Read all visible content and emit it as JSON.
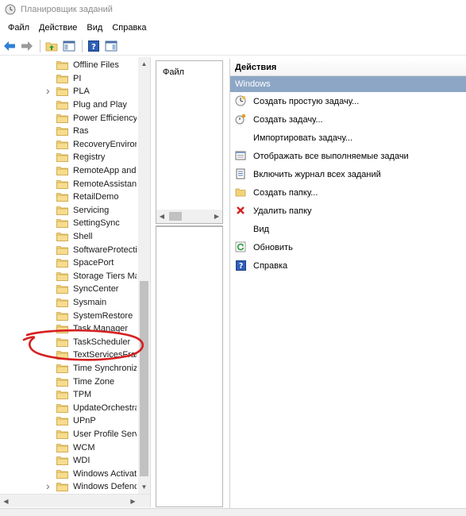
{
  "window": {
    "title": "Планировщик заданий",
    "app_icon": "clock-icon"
  },
  "menu": {
    "items": [
      "Файл",
      "Действие",
      "Вид",
      "Справка"
    ]
  },
  "toolbar": {
    "buttons": [
      "back-arrow-icon",
      "forward-arrow-icon",
      "folder-up-icon",
      "show-hide-tree-icon",
      "help-icon",
      "show-hide-action-pane-icon"
    ]
  },
  "tree": {
    "items": [
      {
        "label": "Offline Files",
        "expandable": false
      },
      {
        "label": "PI",
        "expandable": false
      },
      {
        "label": "PLA",
        "expandable": true
      },
      {
        "label": "Plug and Play",
        "expandable": false
      },
      {
        "label": "Power Efficiency",
        "expandable": false
      },
      {
        "label": "Ras",
        "expandable": false
      },
      {
        "label": "RecoveryEnviron",
        "expandable": false
      },
      {
        "label": "Registry",
        "expandable": false
      },
      {
        "label": "RemoteApp and",
        "expandable": false
      },
      {
        "label": "RemoteAssistanc",
        "expandable": false
      },
      {
        "label": "RetailDemo",
        "expandable": false
      },
      {
        "label": "Servicing",
        "expandable": false
      },
      {
        "label": "SettingSync",
        "expandable": false
      },
      {
        "label": "Shell",
        "expandable": false
      },
      {
        "label": "SoftwareProtecti",
        "expandable": false
      },
      {
        "label": "SpacePort",
        "expandable": false
      },
      {
        "label": "Storage Tiers Ma",
        "expandable": false
      },
      {
        "label": "SyncCenter",
        "expandable": false
      },
      {
        "label": "Sysmain",
        "expandable": false
      },
      {
        "label": "SystemRestore",
        "expandable": false
      },
      {
        "label": "Task Manager",
        "expandable": false
      },
      {
        "label": "TaskScheduler",
        "expandable": false
      },
      {
        "label": "TextServicesFran",
        "expandable": false
      },
      {
        "label": "Time Synchroniz",
        "expandable": false
      },
      {
        "label": "Time Zone",
        "expandable": false
      },
      {
        "label": "TPM",
        "expandable": false
      },
      {
        "label": "UpdateOrchestra",
        "expandable": false
      },
      {
        "label": "UPnP",
        "expandable": false
      },
      {
        "label": "User Profile Servi",
        "expandable": false
      },
      {
        "label": "WCM",
        "expandable": false
      },
      {
        "label": "WDI",
        "expandable": false
      },
      {
        "label": "Windows Activat",
        "expandable": false
      },
      {
        "label": "Windows Defenc",
        "expandable": true
      }
    ]
  },
  "middle": {
    "column_header": "Файл"
  },
  "actions": {
    "header": "Действия",
    "section": "Windows",
    "items": [
      {
        "label": "Создать простую задачу...",
        "icon": "create-basic-task-icon"
      },
      {
        "label": "Создать задачу...",
        "icon": "create-task-icon"
      },
      {
        "label": "Импортировать задачу...",
        "icon": ""
      },
      {
        "label": "Отображать все выполняемые задачи",
        "icon": "running-tasks-icon"
      },
      {
        "label": "Включить журнал всех заданий",
        "icon": "history-log-icon"
      },
      {
        "label": "Создать папку...",
        "icon": "new-folder-icon"
      },
      {
        "label": "Удалить папку",
        "icon": "delete-icon"
      },
      {
        "label": "Вид",
        "icon": ""
      },
      {
        "label": "Обновить",
        "icon": "refresh-icon"
      },
      {
        "label": "Справка",
        "icon": "help-icon"
      }
    ]
  },
  "colors": {
    "section_header_bg": "#8da6c6",
    "annotation_stroke": "#d62020",
    "folder_fill": "#f3d27a"
  },
  "annotation": {
    "type": "red-hand-drawn-circle",
    "target": "TaskScheduler"
  }
}
